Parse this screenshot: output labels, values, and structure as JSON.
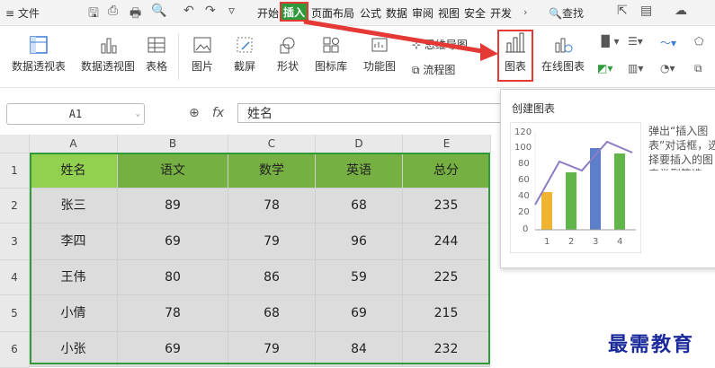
{
  "menubar": {
    "menu_label": "≡ 文件",
    "tabs": [
      "开始",
      "插入",
      "页面布局",
      "公式",
      "数据",
      "审阅",
      "视图",
      "安全",
      "开发"
    ],
    "search_label": "查找"
  },
  "ribbon": {
    "pivot_table": "数据透视表",
    "pivot_chart": "数据透视图",
    "table": "表格",
    "picture": "图片",
    "screenshot": "截屏",
    "shape": "形状",
    "icon_lib": "图标库",
    "function_chart": "功能图",
    "mind_map": "思维导图",
    "flowchart": "流程图",
    "chart": "图表",
    "online_chart": "在线图表"
  },
  "formula_bar": {
    "cell_ref": "A1",
    "fx_label": "fx",
    "value": "姓名"
  },
  "sheet": {
    "columns": [
      "A",
      "B",
      "C",
      "D",
      "E"
    ],
    "rows": [
      "1",
      "2",
      "3",
      "4",
      "5",
      "6"
    ],
    "data": [
      [
        "姓名",
        "语文",
        "数学",
        "英语",
        "总分"
      ],
      [
        "张三",
        "89",
        "78",
        "68",
        "235"
      ],
      [
        "李四",
        "69",
        "79",
        "96",
        "244"
      ],
      [
        "王伟",
        "80",
        "86",
        "59",
        "225"
      ],
      [
        "小倩",
        "78",
        "68",
        "69",
        "215"
      ],
      [
        "小张",
        "69",
        "79",
        "84",
        "232"
      ]
    ]
  },
  "tooltip": {
    "title": "创建图表",
    "description": "弹出“插入图表”对话框，选择要插入的图表类型等选项。",
    "y_ticks": [
      "120",
      "100",
      "80",
      "60",
      "40",
      "20",
      "0"
    ],
    "x_ticks": [
      "1",
      "2",
      "3",
      "4"
    ]
  },
  "watermark": "最需教育",
  "colors": {
    "active_tab": "#2e9a3a",
    "header_green": "#76b043",
    "header_light": "#92d050",
    "highlight_red": "#e53935"
  }
}
